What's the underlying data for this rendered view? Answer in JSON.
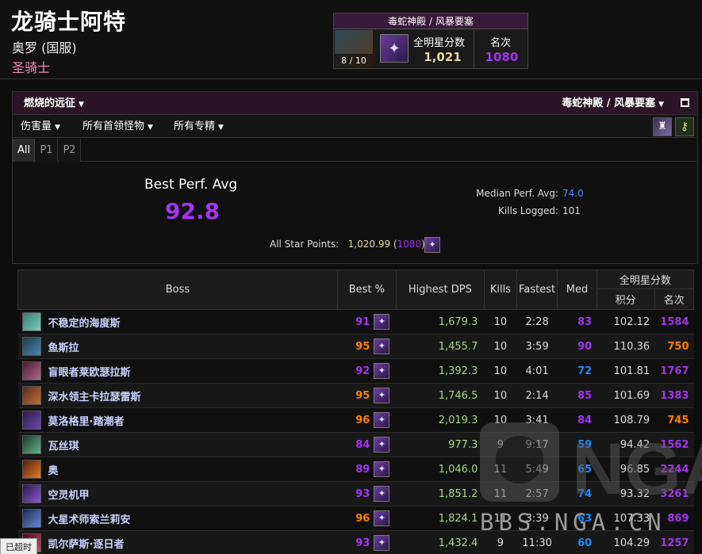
{
  "character": {
    "name": "龙骑士阿特",
    "server": "奥罗 (国服)",
    "class": "圣骑士"
  },
  "raid_summary": {
    "title": "毒蛇神殿 / 风暴要塞",
    "progress": "8 / 10",
    "asp_label": "全明星分数",
    "asp_value": "1,021",
    "rank_label": "名次",
    "rank_value": "1080"
  },
  "filters": {
    "zone": "燃烧的远征",
    "raid": "毒蛇神殿 / 风暴要塞",
    "metric": "伤害量",
    "bosses": "所有首领怪物",
    "specs": "所有专精"
  },
  "tabs": [
    "All",
    "P1",
    "P2"
  ],
  "summary": {
    "best_perf_label": "Best Perf. Avg",
    "best_perf_value": "92.8",
    "median_label": "Median Perf. Avg:",
    "median_value": "74.0",
    "kills_label": "Kills Logged:",
    "kills_value": "101",
    "asp_label": "All Star Points:",
    "asp_points": "1,020.99",
    "asp_rank": "1080"
  },
  "table": {
    "headers": {
      "boss": "Boss",
      "best": "Best %",
      "dps": "Highest DPS",
      "kills": "Kills",
      "fastest": "Fastest",
      "med": "Med",
      "asp_group": "全明星分数",
      "points": "积分",
      "rank": "名次"
    },
    "rows": [
      {
        "boss": "不稳定的海度斯",
        "best": "91",
        "dps": "1,679.3",
        "kills": "10",
        "fastest": "2:28",
        "med": "83",
        "points": "102.12",
        "rank": "1584",
        "best_q": "purple",
        "med_q": "purple",
        "rank_q": "purple",
        "icon": [
          "#3a7a6a",
          "#7ad0c0"
        ]
      },
      {
        "boss": "鱼斯拉",
        "best": "95",
        "dps": "1,455.7",
        "kills": "10",
        "fastest": "3:59",
        "med": "90",
        "points": "110.36",
        "rank": "750",
        "best_q": "orange",
        "med_q": "purple",
        "rank_q": "orange",
        "icon": [
          "#1a3a4a",
          "#4a8ab0"
        ]
      },
      {
        "boss": "盲眼者莱欧瑟拉斯",
        "best": "92",
        "dps": "1,392.3",
        "kills": "10",
        "fastest": "4:01",
        "med": "72",
        "points": "101.81",
        "rank": "1767",
        "best_q": "purple",
        "med_q": "blue",
        "rank_q": "purple",
        "icon": [
          "#4a1a2a",
          "#b06a8a"
        ]
      },
      {
        "boss": "深水领主卡拉瑟雷斯",
        "best": "95",
        "dps": "1,746.5",
        "kills": "10",
        "fastest": "2:14",
        "med": "85",
        "points": "101.69",
        "rank": "1383",
        "best_q": "orange",
        "med_q": "purple",
        "rank_q": "purple",
        "icon": [
          "#5a2a1a",
          "#c0703a"
        ]
      },
      {
        "boss": "莫洛格里·踏潮者",
        "best": "96",
        "dps": "2,019.3",
        "kills": "10",
        "fastest": "3:41",
        "med": "84",
        "points": "108.79",
        "rank": "745",
        "best_q": "orange",
        "med_q": "purple",
        "rank_q": "orange",
        "icon": [
          "#2a1a4a",
          "#6a4ab0"
        ]
      },
      {
        "boss": "瓦丝琪",
        "best": "84",
        "dps": "977.3",
        "kills": "9",
        "fastest": "9:17",
        "med": "59",
        "points": "94.42",
        "rank": "1562",
        "best_q": "purple",
        "med_q": "blue",
        "rank_q": "purple",
        "icon": [
          "#1a3a2a",
          "#6ab08a"
        ]
      },
      {
        "boss": "奥",
        "best": "89",
        "dps": "1,046.0",
        "kills": "11",
        "fastest": "5:49",
        "med": "65",
        "points": "96.85",
        "rank": "2244",
        "best_q": "purple",
        "med_q": "blue",
        "rank_q": "purple",
        "icon": [
          "#5a1a0a",
          "#e0802a"
        ]
      },
      {
        "boss": "空灵机甲",
        "best": "93",
        "dps": "1,851.2",
        "kills": "11",
        "fastest": "2:57",
        "med": "74",
        "points": "93.32",
        "rank": "3261",
        "best_q": "purple",
        "med_q": "blue",
        "rank_q": "purple",
        "icon": [
          "#2a1a4a",
          "#8a5ad0"
        ]
      },
      {
        "boss": "大星术师索兰莉安",
        "best": "96",
        "dps": "1,824.1",
        "kills": "11",
        "fastest": "3:39",
        "med": "63",
        "points": "107.33",
        "rank": "869",
        "best_q": "orange",
        "med_q": "blue",
        "rank_q": "purple",
        "icon": [
          "#1a2a5a",
          "#6a8ad0"
        ]
      },
      {
        "boss": "凯尔萨斯·逐日者",
        "best": "93",
        "dps": "1,432.4",
        "kills": "9",
        "fastest": "11:30",
        "med": "60",
        "points": "104.29",
        "rank": "1257",
        "best_q": "purple",
        "med_q": "blue",
        "rank_q": "purple",
        "icon": [
          "#4a0a1a",
          "#d04a6a"
        ]
      }
    ]
  },
  "watermark": "BBS.NGA.CN",
  "status_tag": "已超时",
  "colors": {
    "purple": "#a335ee",
    "orange": "#ff8000",
    "blue": "#1f8cff",
    "dps": "#a8d88a",
    "asp": "#e3d8a0"
  }
}
